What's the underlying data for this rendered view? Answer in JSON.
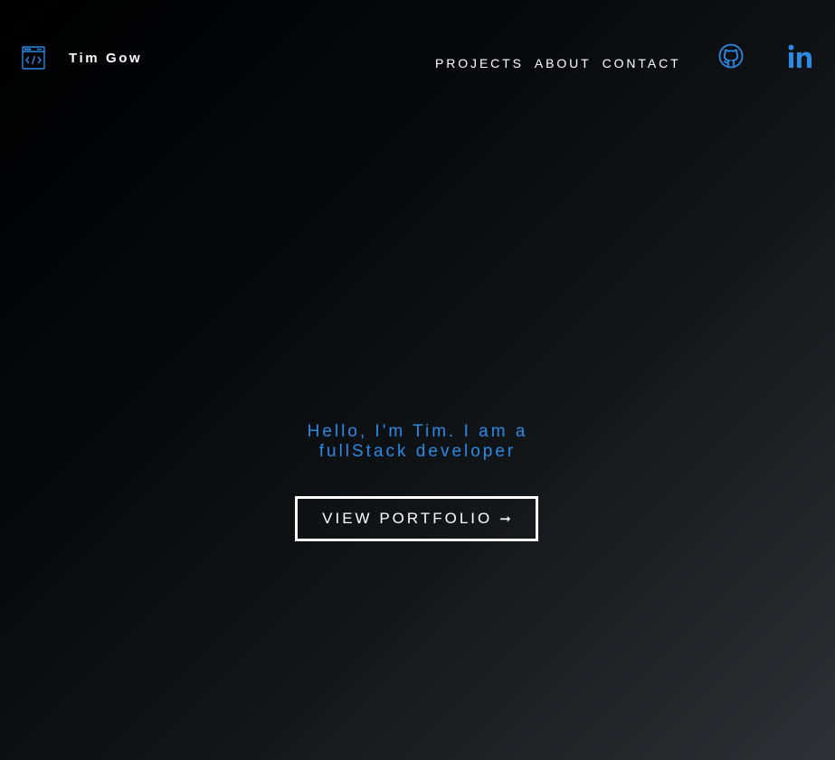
{
  "header": {
    "brand": "Tim Gow",
    "logo_icon": "code-window-icon",
    "nav": [
      "PROJECTS",
      "ABOUT",
      "CONTACT"
    ],
    "social": [
      {
        "icon": "github-icon"
      },
      {
        "icon": "linkedin-icon"
      }
    ]
  },
  "hero": {
    "line1": "Hello, I'm Tim. I am a",
    "line2": "fullStack developer",
    "button_label": "VIEW PORTFOLIO",
    "button_arrow": "➞"
  },
  "colors": {
    "accent": "#2b8ae6",
    "text": "#ffffff",
    "background_start": "#000000",
    "background_end": "#2d3135"
  }
}
